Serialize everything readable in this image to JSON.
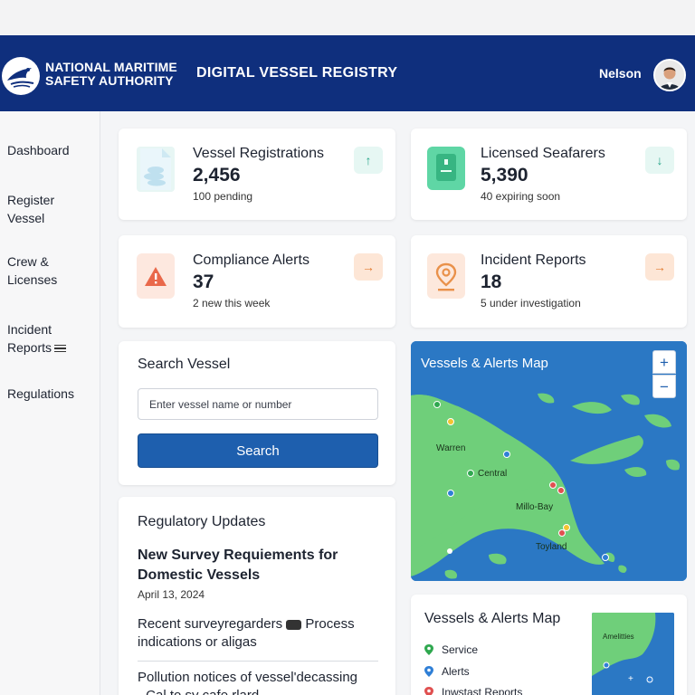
{
  "header": {
    "org_line1": "NATIONAL MARITIME",
    "org_line2": "SAFETY AUTHORITY",
    "app_title": "DIGITAL VESSEL REGISTRY",
    "user_name": "Nelson",
    "color": "#0f2f7d"
  },
  "sidebar": {
    "items": [
      {
        "label": "Dashboard"
      },
      {
        "label": "Register Vessel"
      },
      {
        "label": "Crew & Licenses"
      },
      {
        "label": "Incident Reports",
        "icon": "menu-icon"
      },
      {
        "label": "Regulations"
      }
    ]
  },
  "stats": [
    {
      "title": "Vessel Registrations",
      "value": "2,456",
      "sub": "100 pending",
      "icon": "document-ship-icon",
      "action": "↑",
      "action_icon": "arrow-up-icon",
      "accent": "#e7f6f4"
    },
    {
      "title": "Licensed Seafarers",
      "value": "5,390",
      "sub": "40 expiring soon",
      "icon": "license-icon",
      "action": "↓",
      "action_icon": "arrow-down-icon",
      "accent": "#5fd6a5"
    },
    {
      "title": "Compliance Alerts",
      "value": "37",
      "sub": "2 new this week",
      "icon": "warning-icon",
      "action": "→",
      "action_icon": "arrow-right-icon",
      "accent": "#e9684a"
    },
    {
      "title": "Incident Reports",
      "value": "18",
      "sub": "5 under investigation",
      "icon": "location-pin-icon",
      "action": "→",
      "action_icon": "arrow-right-icon",
      "accent": "#e9914a"
    }
  ],
  "search": {
    "title": "Search Vessel",
    "placeholder": "Enter vessel name or number",
    "button_label": "Search",
    "button_color": "#1e5fae"
  },
  "updates": {
    "title": "Regulatory Updates",
    "headline": "New Survey Requiements for Domestic Vessels",
    "date": "April 13, 2024",
    "item1_a": "Recent surveyregarders",
    "item1_b": "Process indications or aligas",
    "item2": "Pollution notices of vessel'decassing",
    "item3": "- Cal to sy cafe rlard"
  },
  "map": {
    "title": "Vessels & Alerts Map",
    "zoom_in": "+",
    "zoom_out": "−",
    "labels": [
      "Warren",
      "Central",
      "Millo-Bay",
      "Toyland"
    ],
    "land_color": "#6fcf7a",
    "water_color": "#2b78c4"
  },
  "legend": {
    "title": "Vessels & Alerts  Map",
    "items": [
      {
        "label": "Service",
        "color": "#2fa84f"
      },
      {
        "label": "Alerts",
        "color": "#2f7fd6"
      },
      {
        "label": "Inwstast Reports",
        "color": "#e05050"
      }
    ],
    "mini_label": "Amelitties",
    "mini_plus": "+"
  }
}
